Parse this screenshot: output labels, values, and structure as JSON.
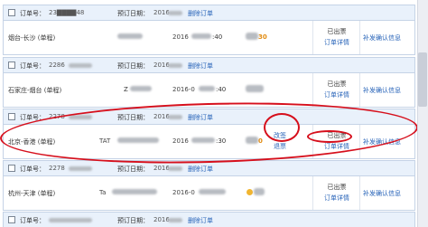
{
  "orders": [
    {
      "order_no_label": "订单号：",
      "order_no": "23▇▇▇▇48",
      "book_date_label": "预订日期：",
      "book_date": "2016",
      "delete_label": "删除订单",
      "route": "烟台-长沙 (单程)",
      "date": "2016",
      "time": ":40",
      "price": "30",
      "status": "已出票",
      "detail": "订单详情",
      "info": "补发确认信息"
    },
    {
      "order_no_label": "订单号：",
      "order_no": "2286",
      "book_date_label": "预订日期：",
      "book_date": "2016",
      "delete_label": "删除订单",
      "route": "石家庄-烟台 (单程)",
      "code": "Z",
      "date": "2016-0",
      "time": ":40",
      "price": "",
      "status": "已出票",
      "detail": "订单详情",
      "info": "补发确认信息"
    },
    {
      "order_no_label": "订单号：",
      "order_no": "2278",
      "book_date_label": "预订日期：",
      "book_date": "2016",
      "delete_label": "删除订单",
      "route": "北京-香港 (单程)",
      "code": "TAT",
      "date": "2016",
      "time": ":30",
      "price": "0",
      "change": "改签",
      "refund": "退票",
      "status": "已出票",
      "detail": "订单详情",
      "info": "补发确认信息"
    },
    {
      "order_no_label": "订单号：",
      "order_no": "2278",
      "book_date_label": "预订日期：",
      "book_date": "2016",
      "delete_label": "删除订单",
      "route": "杭州-天津 (单程)",
      "code": "Ta",
      "date": "2016-0",
      "time": "",
      "price": "",
      "status": "已出票",
      "detail": "订单详情",
      "info": "补发确认信息"
    },
    {
      "order_no_label": "订单号：",
      "order_no": "",
      "book_date_label": "预订日期：",
      "book_date": "2016",
      "delete_label": "删除订单"
    }
  ],
  "colors": {
    "link": "#2763b8",
    "price": "#e28c12",
    "annotation": "#d60f1c",
    "header_bg": "#e9f1fb"
  }
}
